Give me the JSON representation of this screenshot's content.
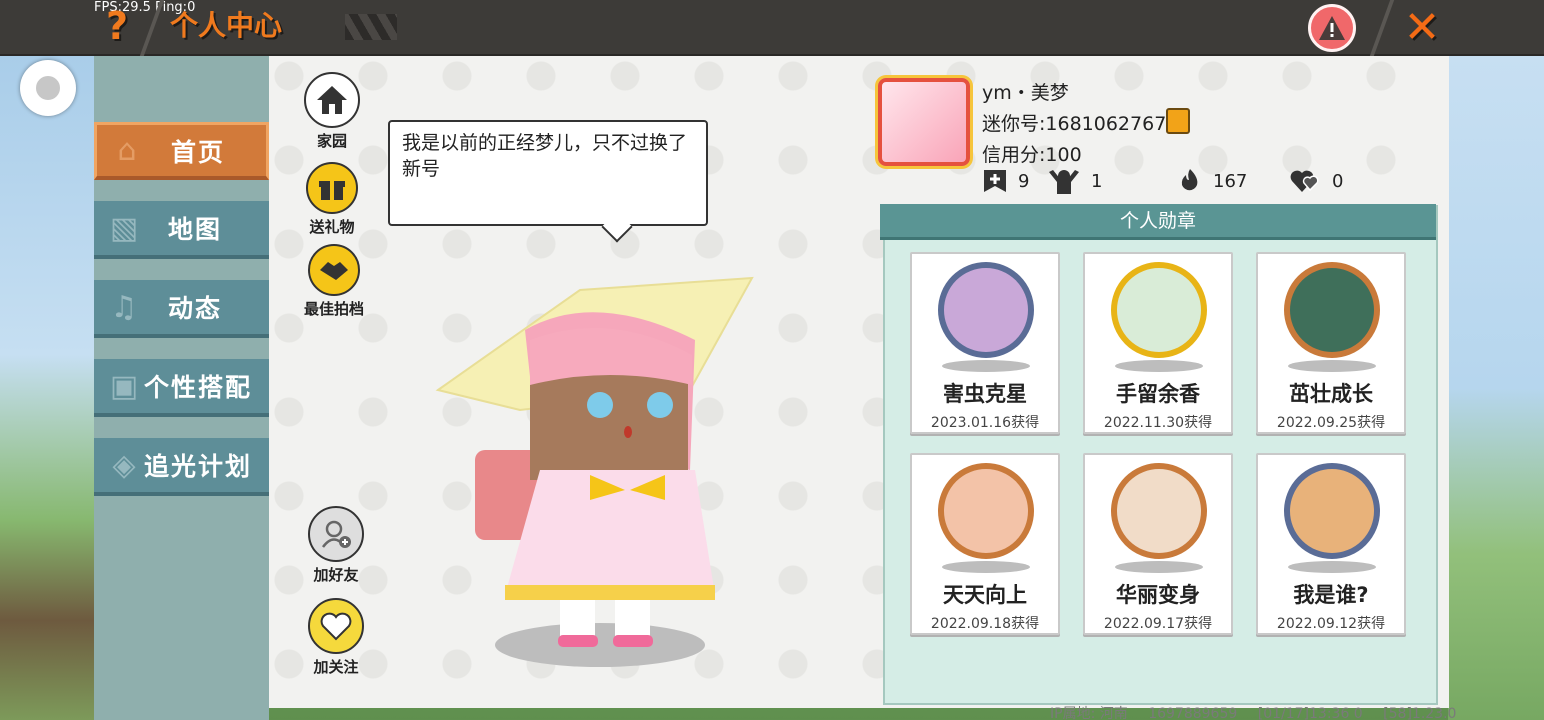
{
  "top_bar": {
    "fps_text": "FPS:29.5  Ping:0",
    "help_label": "?",
    "title": "个人中心",
    "close_label": "✕"
  },
  "nav": {
    "items": [
      {
        "label": "首页",
        "icon": "house-icon",
        "active": true
      },
      {
        "label": "地图",
        "icon": "map-icon",
        "active": false
      },
      {
        "label": "动态",
        "icon": "bell-icon",
        "active": false
      },
      {
        "label": "个性搭配",
        "icon": "outfit-icon",
        "active": false
      },
      {
        "label": "追光计划",
        "icon": "sparkle-plan-icon",
        "active": false
      }
    ]
  },
  "side_actions": {
    "home": "家园",
    "gift": "送礼物",
    "partner": "最佳拍档",
    "add_friend": "加好友",
    "follow": "加关注"
  },
  "bubble_text": "我是以前的正经梦儿，只不过换了新号",
  "profile": {
    "name": "ym・美梦",
    "mini_id": "迷你号:1681062767",
    "credit": "信用分:100",
    "stats": [
      {
        "icon": "bookmark-plus-icon",
        "value": "9"
      },
      {
        "icon": "fans-icon",
        "value": "1"
      },
      {
        "icon": "flame-icon",
        "value": "167"
      },
      {
        "icon": "hearts-icon",
        "value": "0"
      }
    ]
  },
  "medals": {
    "title": "个人勋章",
    "items": [
      {
        "name": "害虫克星",
        "date": "2023.01.16获得",
        "ring": "#5a6c96",
        "fill": "#c9a8d8"
      },
      {
        "name": "手留余香",
        "date": "2022.11.30获得",
        "ring": "#e8b416",
        "fill": "#d9ecd7"
      },
      {
        "name": "茁壮成长",
        "date": "2022.09.25获得",
        "ring": "#c97a3a",
        "fill": "#3f6f5a"
      },
      {
        "name": "天天向上",
        "date": "2022.09.18获得",
        "ring": "#c97a3a",
        "fill": "#f3c3a8"
      },
      {
        "name": "华丽变身",
        "date": "2022.09.17获得",
        "ring": "#c97a3a",
        "fill": "#f1dcc8"
      },
      {
        "name": "我是谁?",
        "date": "2022.09.12获得",
        "ring": "#5a6c96",
        "fill": "#e8b27a"
      }
    ]
  },
  "footer": {
    "ip": "IP属地: 河南",
    "uid": "1697889659",
    "time": "[01/17]13:36 0",
    "version": "[58]1.23.0"
  }
}
